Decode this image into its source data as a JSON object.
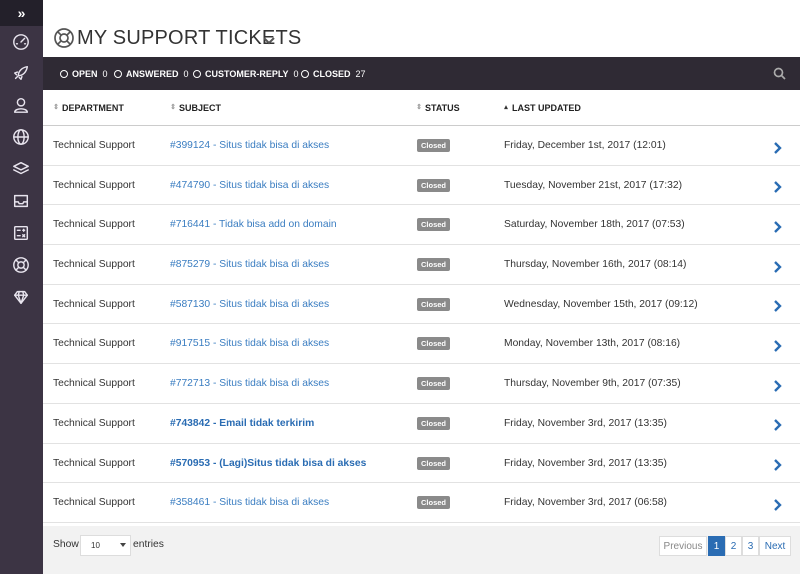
{
  "header": {
    "title": "MY SUPPORT TICKETS"
  },
  "filters": [
    {
      "label": "OPEN",
      "count": "0"
    },
    {
      "label": "ANSWERED",
      "count": "0"
    },
    {
      "label": "CUSTOMER-REPLY",
      "count": "0"
    },
    {
      "label": "CLOSED",
      "count": "27"
    }
  ],
  "table": {
    "columns": [
      "DEPARTMENT",
      "SUBJECT",
      "STATUS",
      "LAST UPDATED"
    ],
    "rows": [
      {
        "department": "Technical Support",
        "subject": "#399124 - Situs tidak bisa di akses",
        "status": "Closed",
        "updated": "Friday, December 1st, 2017 (12:01)"
      },
      {
        "department": "Technical Support",
        "subject": "#474790 - Situs tidak bisa di akses",
        "status": "Closed",
        "updated": "Tuesday, November 21st, 2017 (17:32)"
      },
      {
        "department": "Technical Support",
        "subject": "#716441 - Tidak bisa add on domain",
        "status": "Closed",
        "updated": "Saturday, November 18th, 2017 (07:53)"
      },
      {
        "department": "Technical Support",
        "subject": "#875279 - Situs tidak bisa di akses",
        "status": "Closed",
        "updated": "Thursday, November 16th, 2017 (08:14)"
      },
      {
        "department": "Technical Support",
        "subject": "#587130 - Situs tidak bisa di akses",
        "status": "Closed",
        "updated": "Wednesday, November 15th, 2017 (09:12)"
      },
      {
        "department": "Technical Support",
        "subject": "#917515 - Situs tidak bisa di akses",
        "status": "Closed",
        "updated": "Monday, November 13th, 2017 (08:16)"
      },
      {
        "department": "Technical Support",
        "subject": "#772713 - Situs tidak bisa di akses",
        "status": "Closed",
        "updated": "Thursday, November 9th, 2017 (07:35)"
      },
      {
        "department": "Technical Support",
        "subject": "#743842 - Email tidak terkirim",
        "status": "Closed",
        "updated": "Friday, November 3rd, 2017 (13:35)"
      },
      {
        "department": "Technical Support",
        "subject": "#570953 - (Lagi)Situs tidak bisa di akses",
        "status": "Closed",
        "updated": "Friday, November 3rd, 2017 (13:35)"
      },
      {
        "department": "Technical Support",
        "subject": "#358461 - Situs tidak bisa di akses",
        "status": "Closed",
        "updated": "Friday, November 3rd, 2017 (06:58)"
      }
    ]
  },
  "footer": {
    "show_label": "Show",
    "page_size": "10",
    "entries_label": "entries",
    "prev_label": "Previous",
    "pages": [
      "1",
      "2",
      "3"
    ],
    "next_label": "Next"
  },
  "colors": {
    "sidebar": "#3c3444",
    "filterbar": "#2f2a34",
    "link": "#2a6cb3",
    "badge": "#8a8a8a"
  }
}
